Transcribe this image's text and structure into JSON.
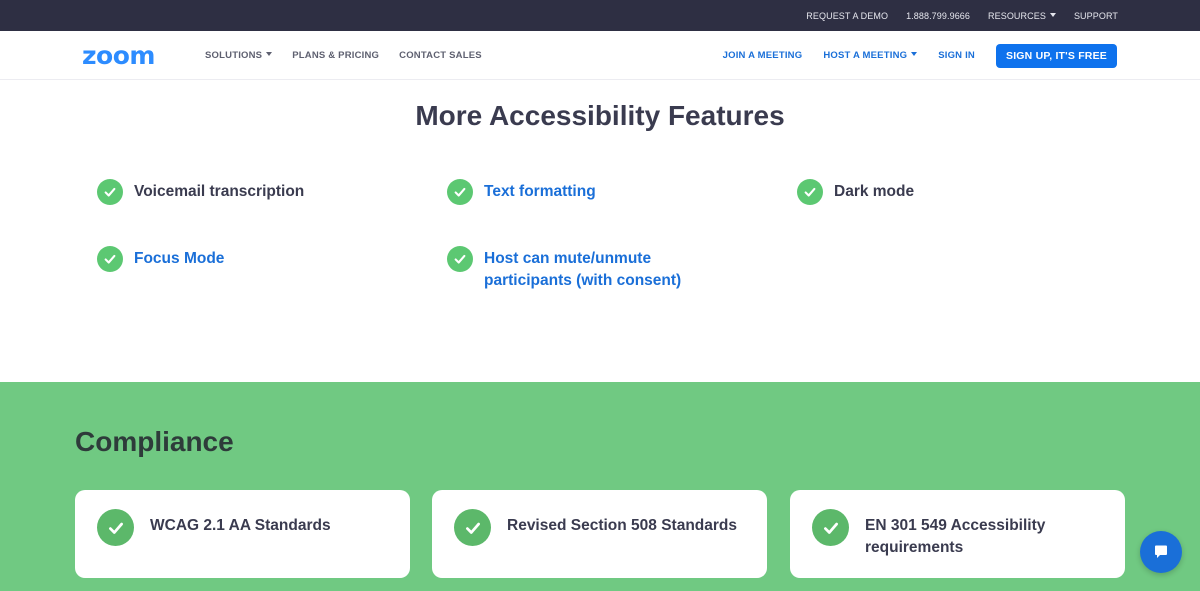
{
  "topbar": {
    "links": [
      "REQUEST A DEMO",
      "1.888.799.9666",
      "RESOURCES",
      "SUPPORT"
    ]
  },
  "navbar": {
    "logo": "zoom",
    "left_links": [
      "SOLUTIONS",
      "PLANS & PRICING",
      "CONTACT SALES"
    ],
    "right_links": [
      "JOIN A MEETING",
      "HOST A MEETING",
      "SIGN IN"
    ],
    "signup_label": "SIGN UP, IT'S FREE"
  },
  "features": {
    "title": "More Accessibility Features",
    "items": [
      "Voicemail transcription",
      "Text formatting",
      "Dark mode",
      "Focus Mode",
      "Host can mute/unmute participants (with consent)"
    ]
  },
  "compliance": {
    "title": "Compliance",
    "cards": [
      "WCAG 2.1 AA Standards",
      "Revised Section 508 Standards",
      "EN 301 549 Accessibility requirements"
    ]
  },
  "icons": {
    "check": "check-circle-icon",
    "chat": "chat-bubble-icon",
    "caret": "caret-down-icon"
  },
  "colors": {
    "brand_blue": "#2d8cff",
    "link_blue": "#1a6fd8",
    "topbar_bg": "#2e2f43",
    "check_green": "#5cc872",
    "compliance_bg": "#70c982",
    "signup_bg": "#0e72ed"
  }
}
